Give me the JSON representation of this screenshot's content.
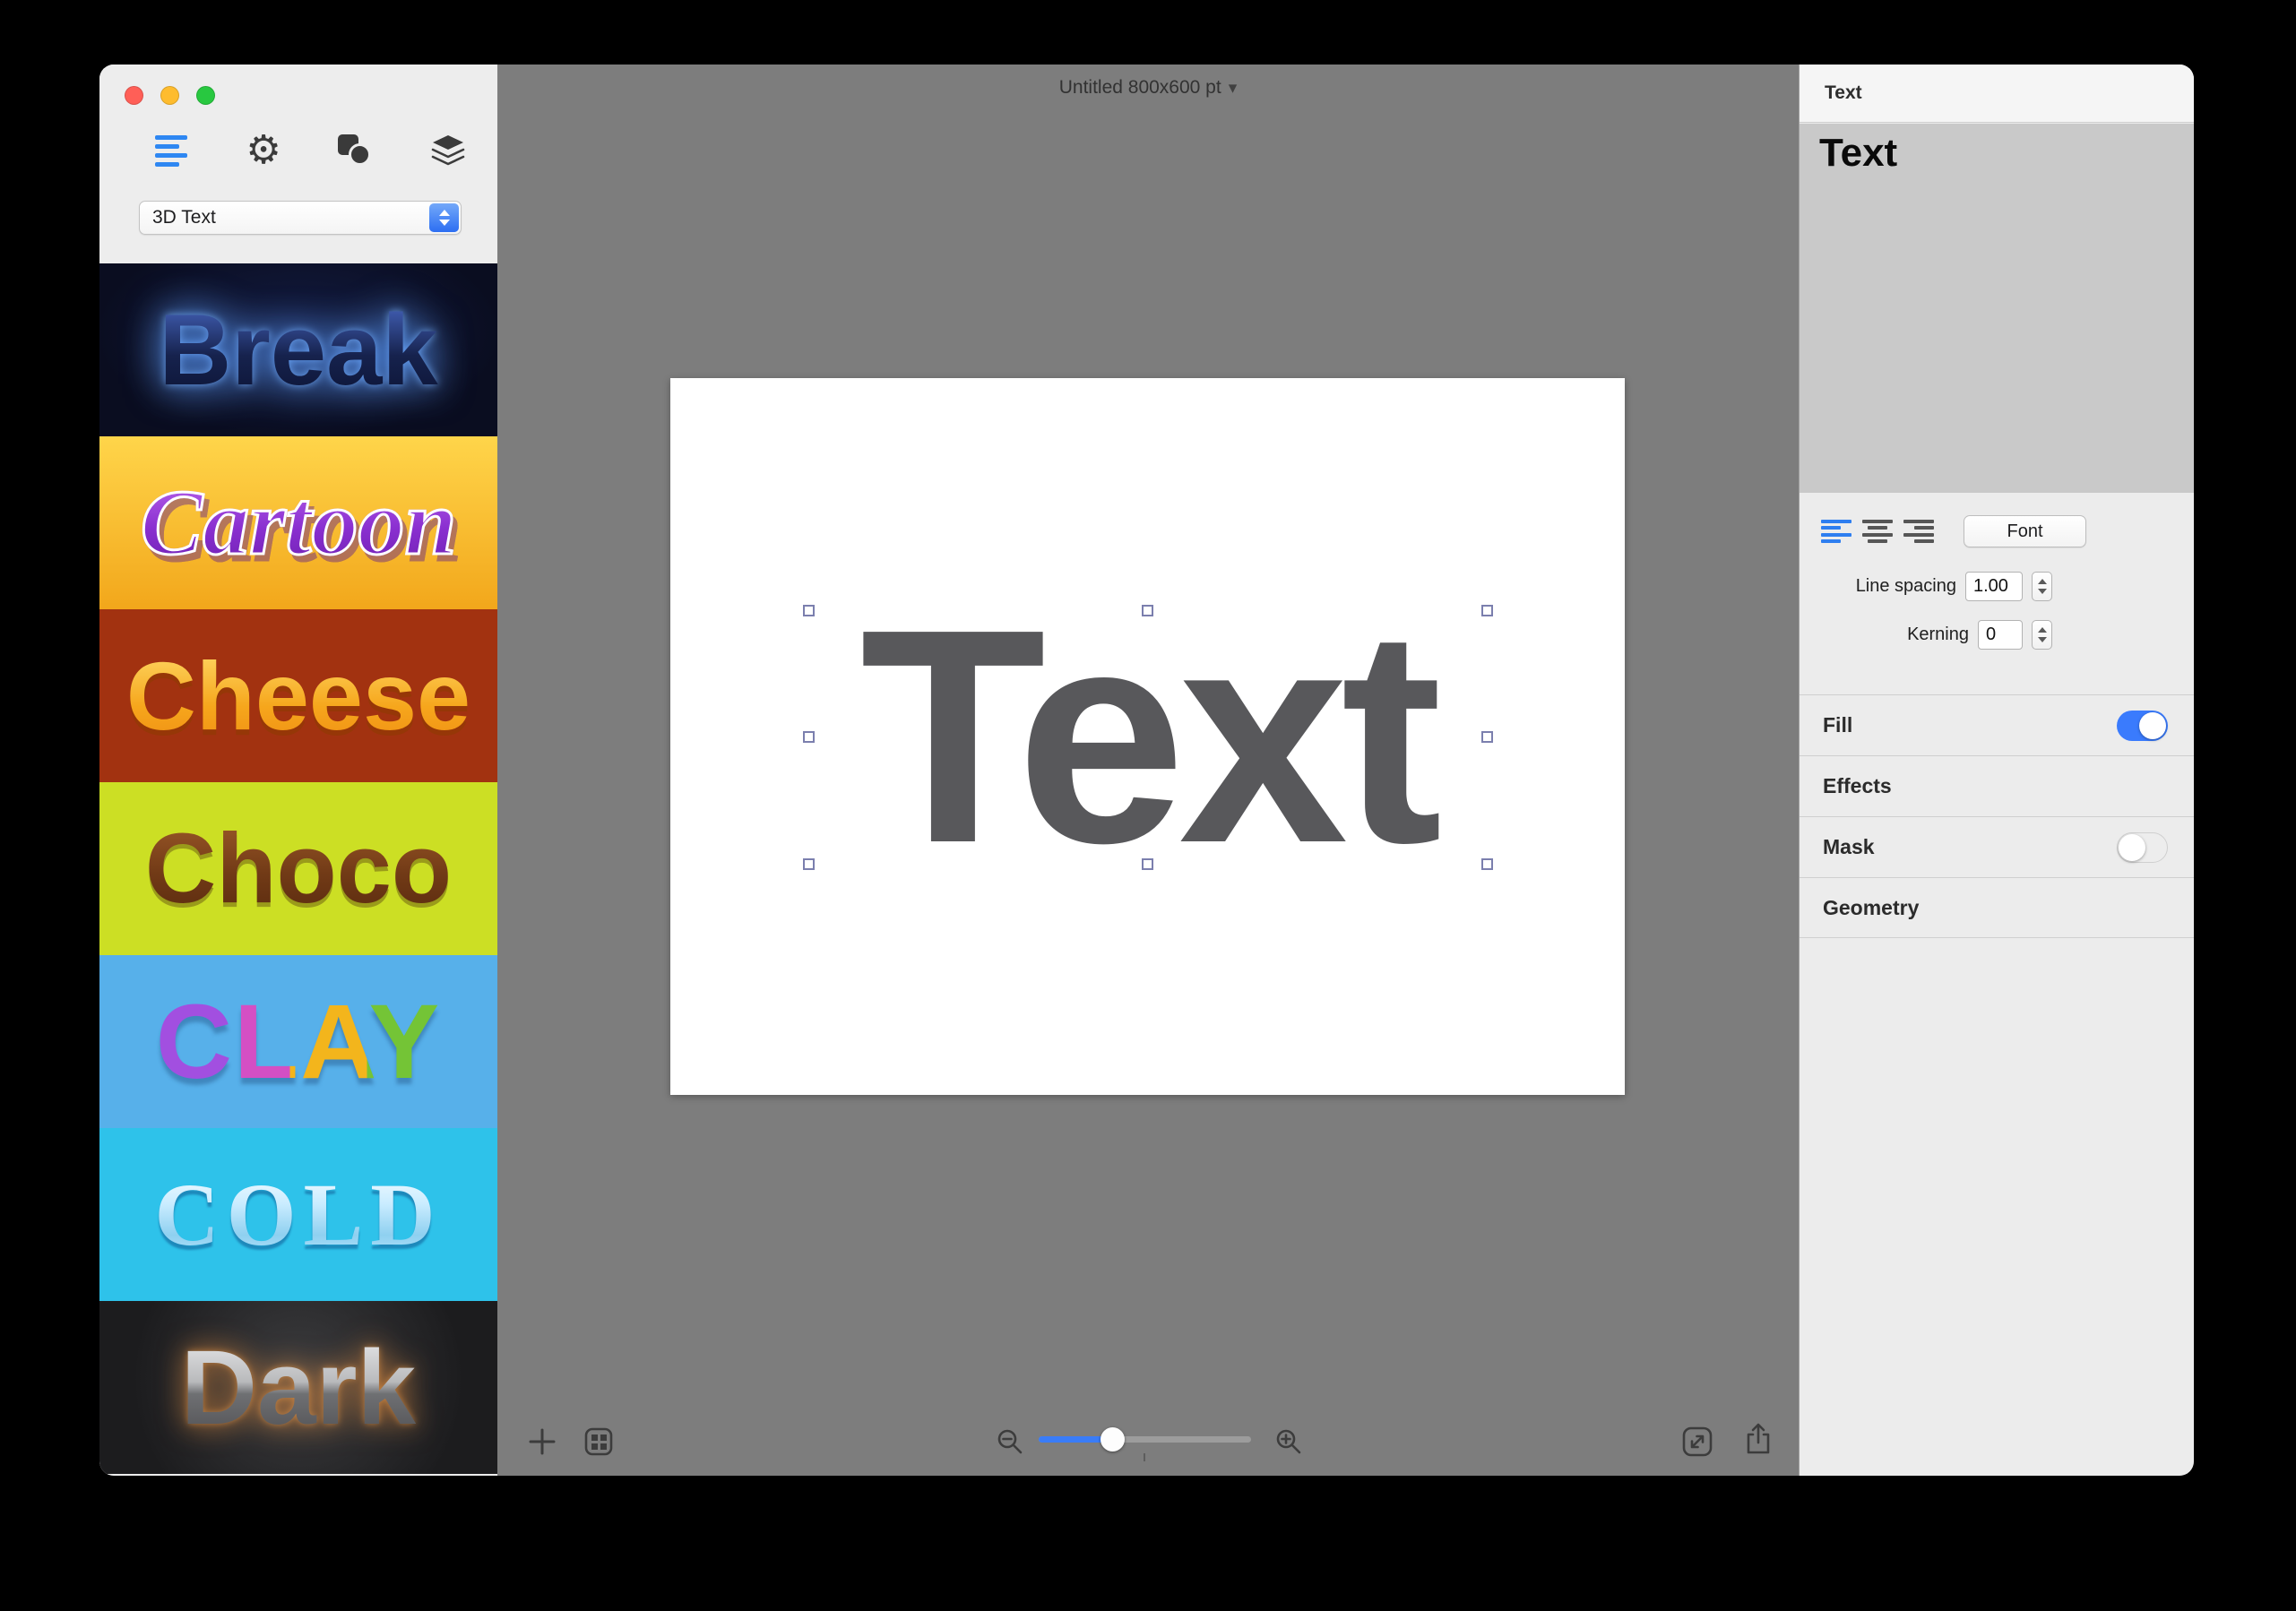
{
  "window": {
    "title": "Untitled 800x600 pt"
  },
  "icons": {
    "gear": "⚙",
    "chevron_down": "▾"
  },
  "sidebar": {
    "dropdown_value": "3D Text",
    "styles": [
      {
        "label": "Break"
      },
      {
        "label": "Cartoon"
      },
      {
        "label": "Cheese"
      },
      {
        "label": "Choco"
      },
      {
        "label": "CLAY"
      },
      {
        "label": "COLD"
      },
      {
        "label": "Dark"
      }
    ]
  },
  "canvas": {
    "text": "Text",
    "zoom_fraction": 0.35
  },
  "inspector": {
    "header": "Text",
    "text_value": "Text",
    "font_button": "Font",
    "line_spacing_label": "Line spacing",
    "line_spacing_value": "1.00",
    "kerning_label": "Kerning",
    "kerning_value": "0",
    "sections": {
      "fill": "Fill",
      "effects": "Effects",
      "mask": "Mask",
      "geometry": "Geometry"
    },
    "toggles": {
      "fill": "on",
      "mask": "off"
    }
  },
  "colors": {
    "accent_blue": "#3a7bfd",
    "canvas_gray": "#7d7d7d",
    "toggle_on": "#3a7bfd",
    "thumb_break_bg": "#0a0d20",
    "thumb_cartoon_bg": "#f2a71b",
    "thumb_cheese_bg": "#a23210",
    "thumb_choco_bg": "#ccdf24",
    "thumb_clay_bg": "#57b0ea",
    "thumb_cold_bg": "#2ec2ea",
    "thumb_dark_bg": "#1c1c1e"
  }
}
